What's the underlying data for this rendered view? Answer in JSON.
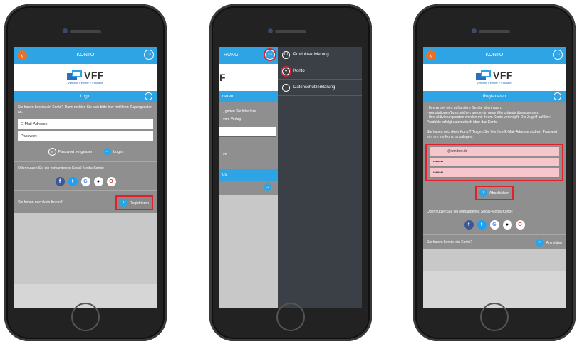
{
  "logo": {
    "name": "VFF",
    "subtitle": "Verband Fenster + Fassade"
  },
  "phone1": {
    "title": "KONTO",
    "section": "Login",
    "intro": "Sie haben bereits ein Konto? Dann melden Sie sich bitte hier mit Ihren Zugangsdaten an.",
    "email_placeholder": "E-Mail-Adresse",
    "password_placeholder": "Passwort",
    "forgot": "Passwort vergessen",
    "login": "Login",
    "social_text": "Oder nutzen Sie ein vorhandenes Social-Media-Konto:",
    "no_account": "Sie haben noch kein Konto?",
    "register": "Registrieren"
  },
  "phone2": {
    "title_partial": "RUNG",
    "section_partial": "rieren",
    "text_partial_1": ", geben Sie bitte Ihre",
    "text_partial_2": "vom Verlag.",
    "text_partial_3": "en",
    "bar_partial": "us",
    "menu": [
      {
        "label": "Produktaktivierung",
        "icon": "power-icon"
      },
      {
        "label": "Konto",
        "icon": "user-icon"
      },
      {
        "label": "Datenschutzerklärung",
        "icon": "info-icon"
      }
    ]
  },
  "phone3": {
    "title": "KONTO",
    "section": "Registrieren",
    "info_lines": [
      "- Ihre Arbeit wird auf andere Geräte übertragen.",
      "- Annotationen/Lesezeichen werden in neue Werkstände übernommen.",
      "- Ihre Aktivierungsdaten werden mit Ihrem Konto verknüpft: Der Zugriff auf Ihre Produkte erfolgt automatisch über das Konto."
    ],
    "intro": "Sie haben noch kein Konto? Tragen Sie hier Ihre E-Mail-Adresse und ein Passwort ein, um ein Konto anzulegen.",
    "email_value": "@window.de",
    "password_value": "••••••••",
    "password_confirm_value": "••••••••",
    "submit": "Abschicken",
    "social_text": "Oder nutzen Sie ein vorhandenes Social-Media-Konto:",
    "has_account": "Sie haben bereits ein Konto?",
    "login": "Anmelden"
  },
  "colors": {
    "accent": "#2fa4e4",
    "back": "#e6722a",
    "highlight": "#e0202a",
    "menu_bg": "#3a4046"
  }
}
